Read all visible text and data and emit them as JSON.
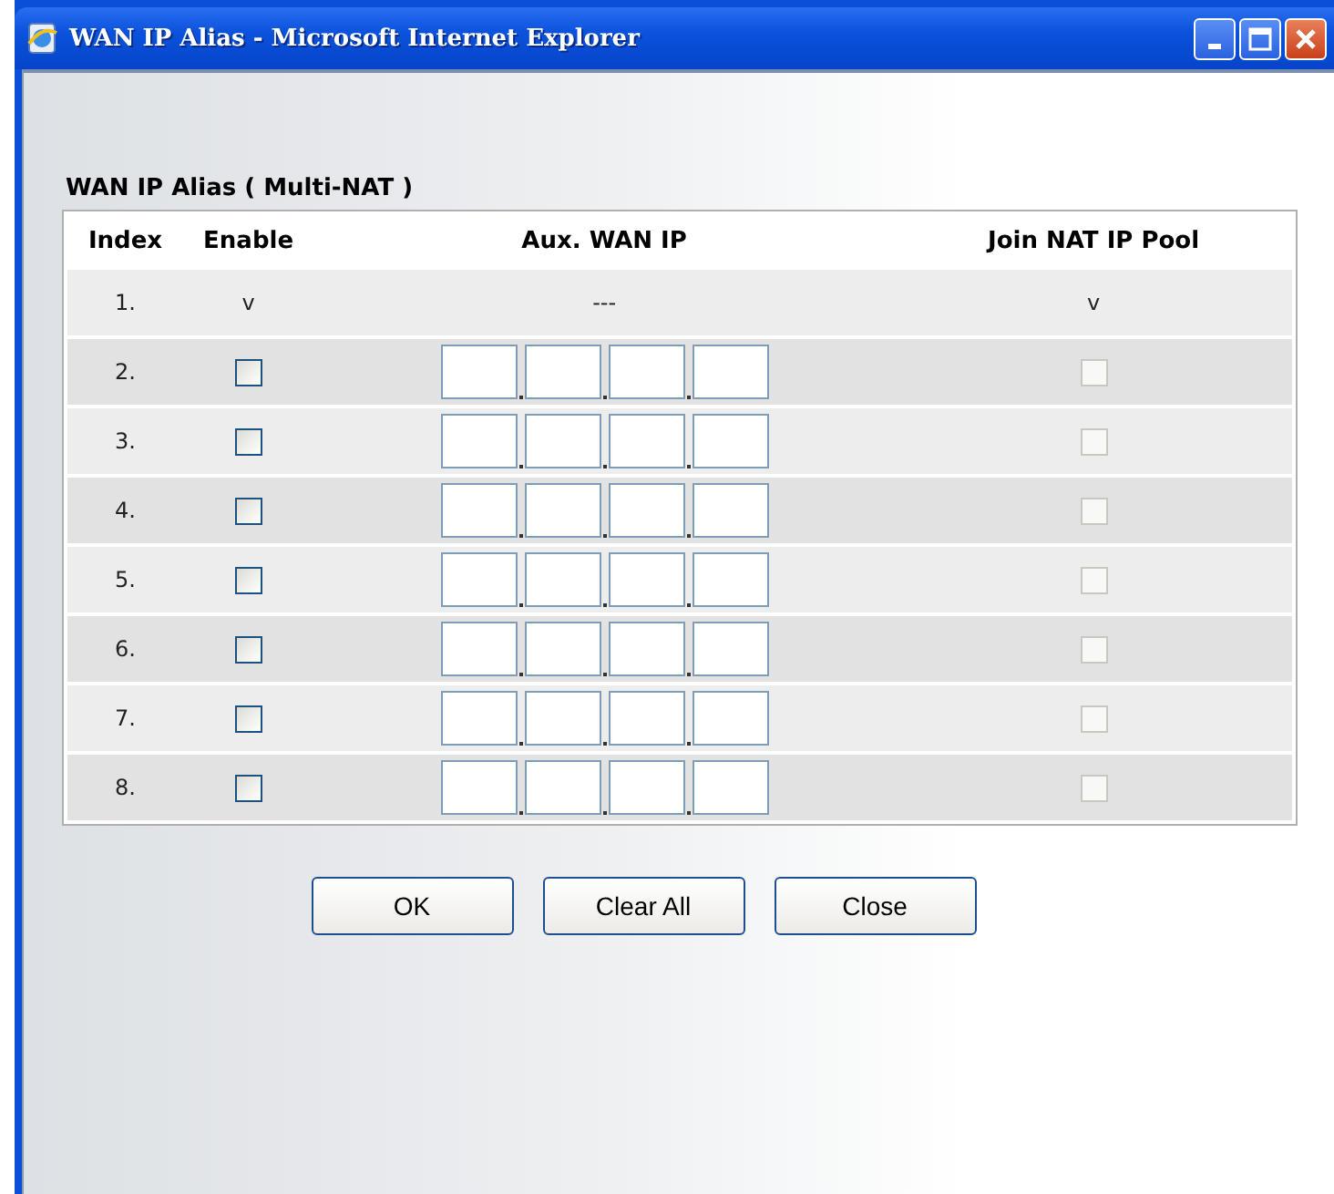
{
  "window": {
    "title": "WAN IP Alias - Microsoft Internet Explorer"
  },
  "heading": "WAN IP Alias ( Multi-NAT )",
  "table": {
    "columns": [
      "Index",
      "Enable",
      "Aux. WAN IP",
      "Join NAT IP Pool"
    ],
    "rows": [
      {
        "index": "1.",
        "kind": "fixed",
        "enable": "v",
        "ip": "---",
        "join": "v"
      },
      {
        "index": "2.",
        "kind": "editable",
        "enable_checked": false,
        "join_checked": false,
        "join_disabled": true
      },
      {
        "index": "3.",
        "kind": "editable",
        "enable_checked": false,
        "join_checked": false,
        "join_disabled": true
      },
      {
        "index": "4.",
        "kind": "editable",
        "enable_checked": false,
        "join_checked": false,
        "join_disabled": true
      },
      {
        "index": "5.",
        "kind": "editable",
        "enable_checked": false,
        "join_checked": false,
        "join_disabled": true
      },
      {
        "index": "6.",
        "kind": "editable",
        "enable_checked": false,
        "join_checked": false,
        "join_disabled": true
      },
      {
        "index": "7.",
        "kind": "editable",
        "enable_checked": false,
        "join_checked": false,
        "join_disabled": true
      },
      {
        "index": "8.",
        "kind": "editable",
        "enable_checked": false,
        "join_checked": false,
        "join_disabled": true
      }
    ]
  },
  "buttons": [
    "OK",
    "Clear All",
    "Close"
  ]
}
